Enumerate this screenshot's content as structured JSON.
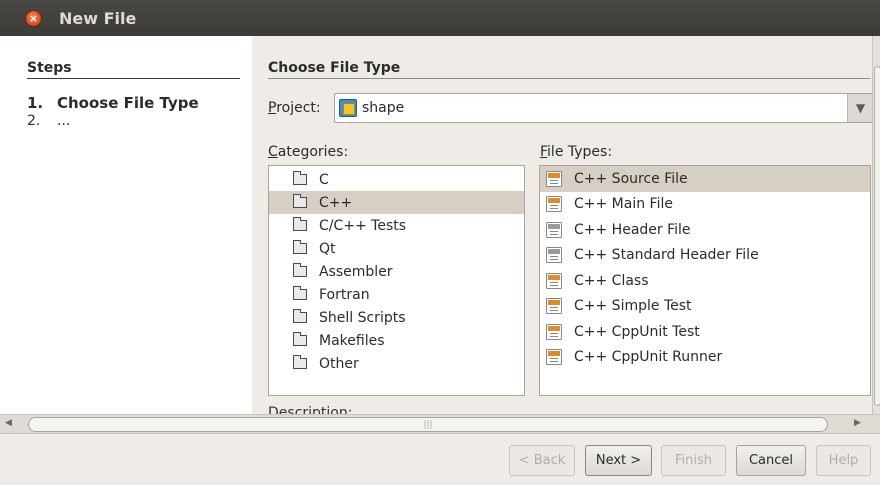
{
  "window": {
    "title": "New File",
    "close_glyph": "×"
  },
  "steps": {
    "heading": "Steps",
    "items": [
      {
        "num": "1.",
        "label": "Choose File Type"
      },
      {
        "num": "2.",
        "label": "..."
      }
    ]
  },
  "content": {
    "heading": "Choose File Type",
    "project": {
      "label_u": "P",
      "label_rest": "roject:",
      "value": "shape"
    },
    "categories": {
      "label_u": "C",
      "label_rest": "ategories:",
      "items": [
        "C",
        "C++",
        "C/C++ Tests",
        "Qt",
        "Assembler",
        "Fortran",
        "Shell Scripts",
        "Makefiles",
        "Other"
      ],
      "selected": "C++"
    },
    "file_types": {
      "label_u": "F",
      "label_rest": "ile Types:",
      "items": [
        "C++ Source File",
        "C++ Main File",
        "C++ Header File",
        "C++ Standard Header File",
        "C++ Class",
        "C++ Simple Test",
        "C++ CppUnit Test",
        "C++ CppUnit Runner"
      ],
      "selected": "C++ Source File"
    },
    "description_label": "Description:"
  },
  "buttons": {
    "back": "< Back",
    "next": "Next >",
    "finish": "Finish",
    "cancel": "Cancel",
    "help": "Help"
  },
  "icons": {
    "close": "close-icon",
    "project": "project-icon",
    "folder": "folder-icon",
    "file": "file-icon"
  }
}
